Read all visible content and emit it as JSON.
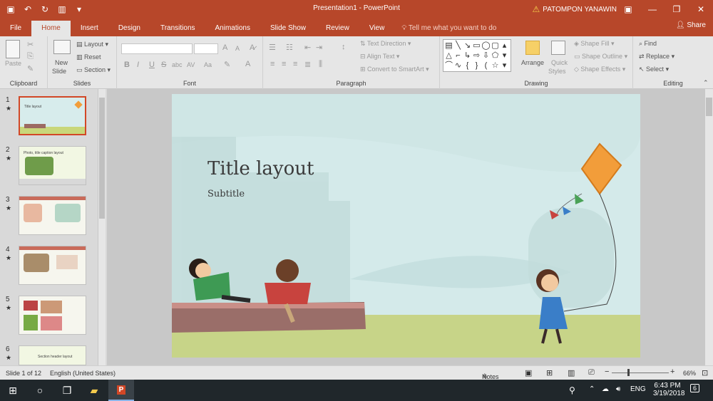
{
  "window": {
    "title": "Presentation1 - PowerPoint",
    "user": "PATOMPON YANAWIN",
    "share": "Share"
  },
  "tabs": [
    "File",
    "Home",
    "Insert",
    "Design",
    "Transitions",
    "Animations",
    "Slide Show",
    "Review",
    "View"
  ],
  "tell_me": "Tell me what you want to do",
  "ribbon": {
    "clipboard": {
      "paste": "Paste",
      "label": "Clipboard"
    },
    "slides": {
      "new_slide": "New",
      "new_slide_2": "Slide",
      "layout": "Layout",
      "reset": "Reset",
      "section": "Section",
      "label": "Slides"
    },
    "font": {
      "label": "Font",
      "bold": "B",
      "italic": "I",
      "underline": "U",
      "strike": "S",
      "shadow": "abc",
      "spacing": "AV",
      "case": "Aa",
      "grow": "A",
      "shrink": "A"
    },
    "paragraph": {
      "label": "Paragraph",
      "text_direction": "Text Direction",
      "align_text": "Align Text",
      "smartart": "Convert to SmartArt"
    },
    "drawing": {
      "label": "Drawing",
      "arrange": "Arrange",
      "quick_styles": "Quick",
      "quick_styles_2": "Styles",
      "shape_fill": "Shape Fill",
      "shape_outline": "Shape Outline",
      "shape_effects": "Shape Effects"
    },
    "editing": {
      "label": "Editing",
      "find": "Find",
      "replace": "Replace",
      "select": "Select"
    }
  },
  "thumbnails": [
    {
      "num": "1",
      "text": "Title layout"
    },
    {
      "num": "2",
      "text": "Photo, title caption layout"
    },
    {
      "num": "3",
      "text": ""
    },
    {
      "num": "4",
      "text": ""
    },
    {
      "num": "5",
      "text": ""
    },
    {
      "num": "6",
      "text": "Section header layout"
    }
  ],
  "slide": {
    "title": "Title layout",
    "subtitle": "Subtitle"
  },
  "status": {
    "slide_info": "Slide 1 of 12",
    "language": "English (United States)",
    "notes": "Notes",
    "zoom": "66%"
  },
  "taskbar": {
    "lang": "ENG",
    "time": "6:43 PM",
    "date": "3/19/2018",
    "notif": "6"
  },
  "colors": {
    "accent": "#b7472a",
    "ribbon": "#e6e6e6",
    "selection": "#d24726"
  }
}
